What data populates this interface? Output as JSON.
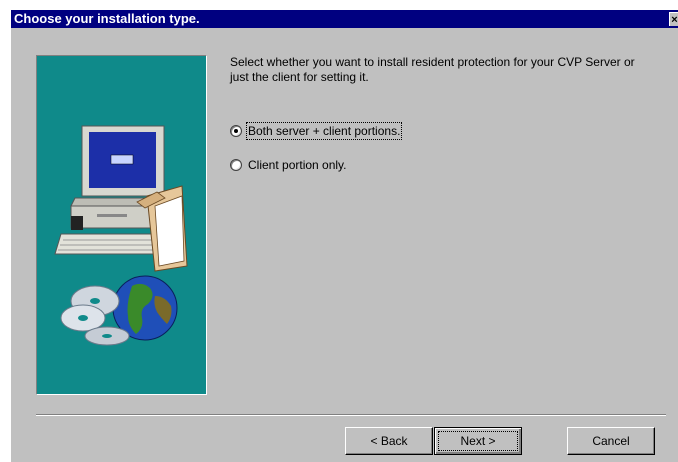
{
  "window": {
    "title": "Choose your installation type.",
    "close_glyph": "×"
  },
  "instructions": "Select whether you want to install resident protection for your CVP Server or just the client for setting it.",
  "options": [
    {
      "label": "Both server + client portions.",
      "selected": true
    },
    {
      "label": "Client portion only.",
      "selected": false
    }
  ],
  "buttons": {
    "back_label": "< Back",
    "next_label": "Next >",
    "cancel_label": "Cancel"
  },
  "colors": {
    "titlebar": "#000080",
    "dialog_bg": "#c0c0c0",
    "art_bg": "#0f8a8a"
  }
}
